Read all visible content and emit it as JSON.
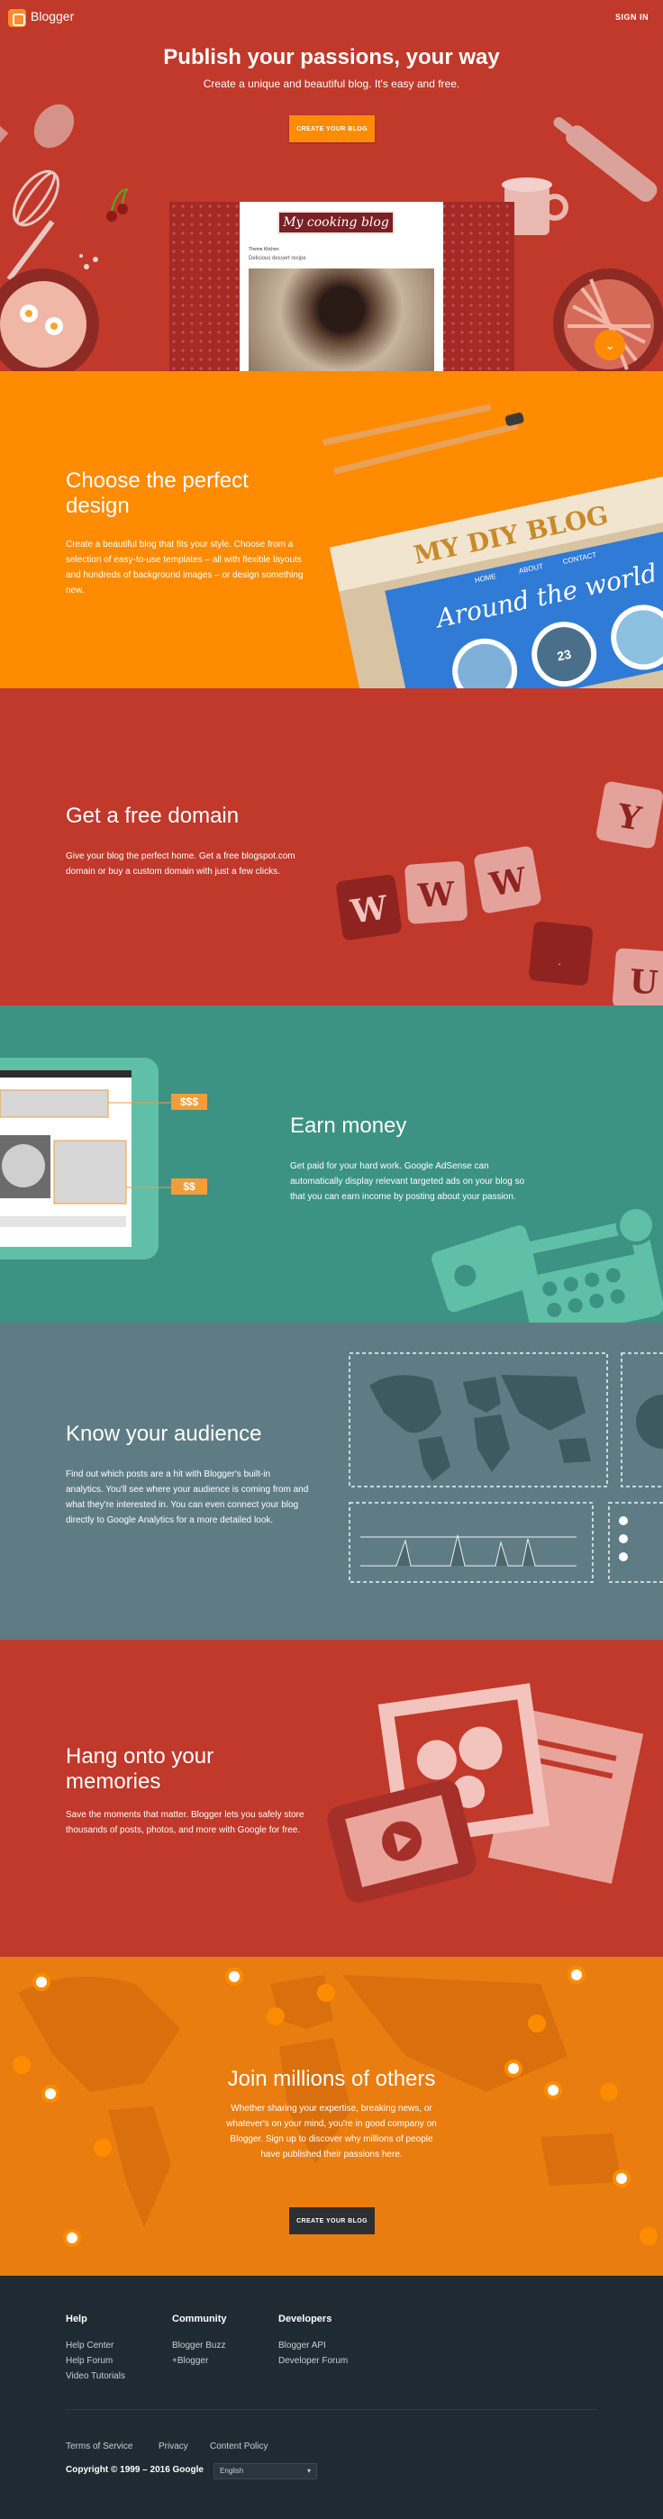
{
  "header": {
    "logo_text": "Blogger",
    "signin_label": "SIGN IN"
  },
  "hero": {
    "title": "Publish your passions, your way",
    "subtitle": "Create a unique and beautiful blog. It's easy and free.",
    "cta_label": "CREATE YOUR BLOG",
    "preview_blog_title": "My cooking blog",
    "preview_small_text": "Theme Kitchen",
    "preview_post_title": "Delicious dessert recipe"
  },
  "sections": {
    "design": {
      "title": "Choose the perfect design",
      "body": "Create a beautiful blog that fits your style. Choose from a selection of easy-to-use templates – all with flexible layouts and hundreds of background images – or design something new.",
      "illustration_title_1": "MY DIY BLOG",
      "illustration_title_2": "Around the world",
      "illustration_nav": [
        "HOME",
        "ABOUT",
        "CONTACT"
      ],
      "illustration_badge": "23"
    },
    "domain": {
      "title": "Get a free domain",
      "body": "Give your blog the perfect home. Get a free blogspot.com domain or buy a custom domain with just a few clicks.",
      "tiles": [
        "W",
        "W",
        "W",
        "Y",
        ".",
        "U"
      ]
    },
    "money": {
      "title": "Earn money",
      "body": "Get paid for your hard work. Google AdSense can automatically display relevant targeted ads on your blog so that you can earn income by posting about your passion.",
      "tag1": "$$$",
      "tag2": "$$"
    },
    "audience": {
      "title": "Know your audience",
      "body": "Find out which posts are a hit with Blogger's built-in analytics. You'll see where your audience is coming from and what they're interested in. You can even connect your blog directly to Google Analytics for a more detailed look."
    },
    "memories": {
      "title": "Hang onto your memories",
      "body": "Save the moments that matter. Blogger lets you safely store thousands of posts, photos, and more with Google for free."
    },
    "others": {
      "title": "Join millions of others",
      "body": "Whether sharing your expertise, breaking news, or whatever's on your mind, you're in good company on Blogger. Sign up to discover why millions of people have published their passions here.",
      "cta_label": "CREATE YOUR BLOG"
    }
  },
  "footer": {
    "columns": [
      {
        "heading": "Help",
        "links": [
          "Help Center",
          "Help Forum",
          "Video Tutorials"
        ]
      },
      {
        "heading": "Community",
        "links": [
          "Blogger Buzz",
          "+Blogger"
        ]
      },
      {
        "heading": "Developers",
        "links": [
          "Blogger API",
          "Developer Forum"
        ]
      }
    ],
    "legal_links": [
      "Terms of Service",
      "Privacy",
      "Content Policy"
    ],
    "copyright": "Copyright © 1999 – 2016 Google",
    "language": "English"
  },
  "colors": {
    "red": "#c0392b",
    "orange": "#ff8b00",
    "teal": "#3c9283",
    "slate": "#5f7c84",
    "footer": "#1f2a32"
  }
}
